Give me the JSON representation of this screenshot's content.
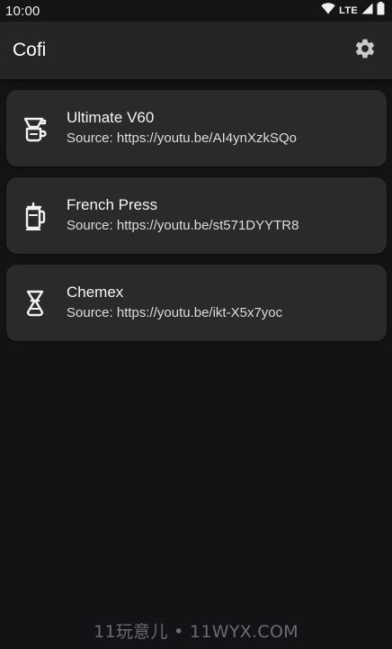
{
  "status_bar": {
    "time": "10:00",
    "network_label": "LTE",
    "icons": [
      "wifi-icon",
      "cell-signal-icon",
      "battery-icon"
    ]
  },
  "app_bar": {
    "title": "Cofi",
    "settings_icon": "gear-icon"
  },
  "recipes": [
    {
      "name": "Ultimate V60",
      "source": "Source: https://youtu.be/AI4ynXzkSQo",
      "icon": "v60-dripper-icon"
    },
    {
      "name": "French Press",
      "source": "Source: https://youtu.be/st571DYYTR8",
      "icon": "french-press-icon"
    },
    {
      "name": "Chemex",
      "source": "Source: https://youtu.be/ikt-X5x7yoc",
      "icon": "chemex-icon"
    }
  ],
  "watermark": "11玩意儿 • 11WYX.COM",
  "colors": {
    "background": "#141214",
    "app_bar": "#262426",
    "card": "#2b292b",
    "text": "#f4f4f4"
  }
}
